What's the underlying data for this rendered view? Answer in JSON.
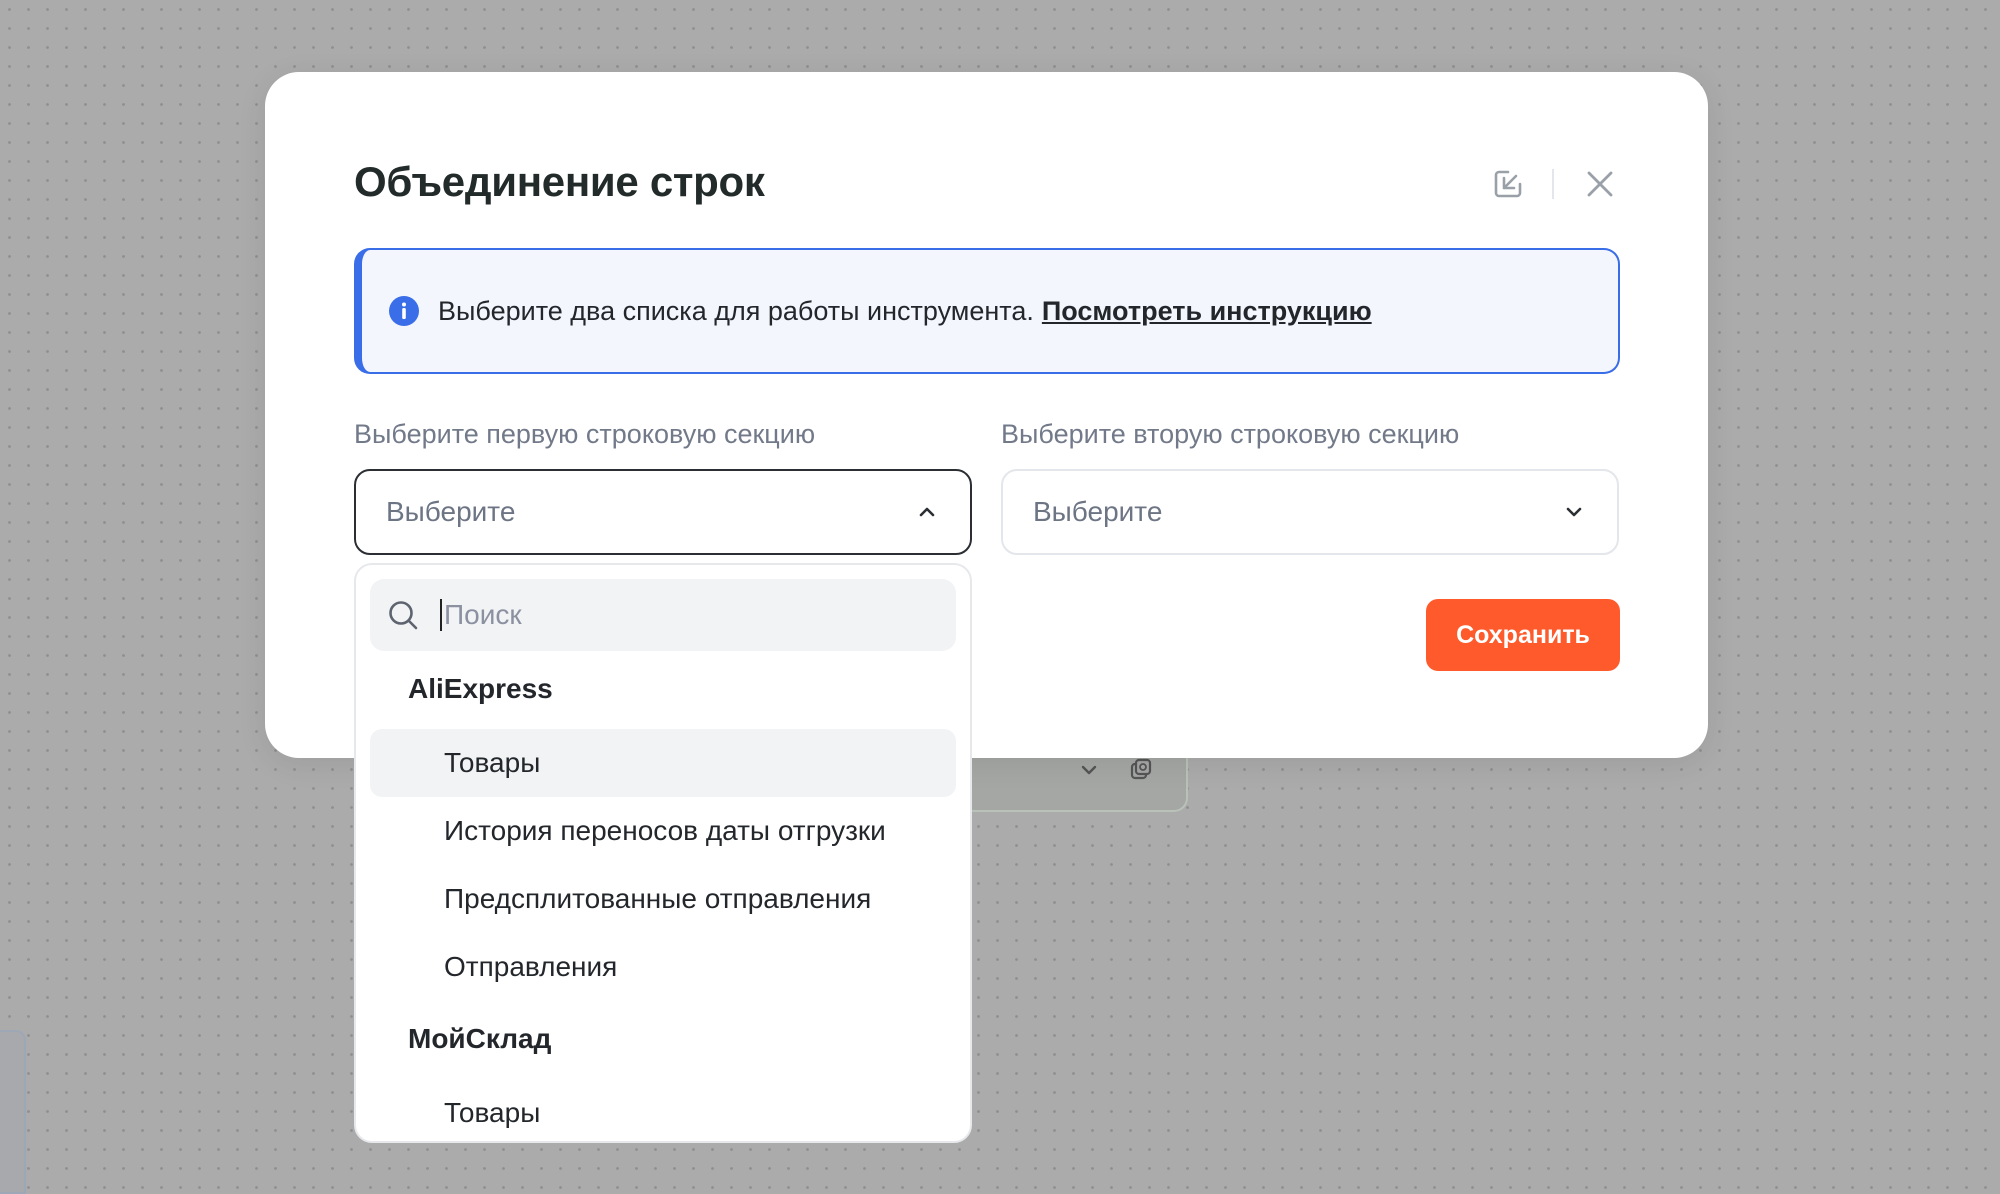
{
  "modal": {
    "title": "Объединение строк",
    "info": {
      "text": "Выберите два списка для работы инструмента.",
      "link": "Посмотреть инструкцию"
    },
    "first_section": {
      "label": "Выберите первую строковую секцию",
      "value": "Выберите",
      "state": "open"
    },
    "second_section": {
      "label": "Выберите вторую строковую секцию",
      "value": "Выберите",
      "state": "closed"
    },
    "save_label": "Сохранить"
  },
  "dropdown": {
    "search_placeholder": "Поиск",
    "search_value": "",
    "groups": [
      {
        "name": "AliExpress",
        "items": [
          {
            "label": "Товары",
            "highlighted": true
          },
          {
            "label": "История переносов даты отгрузки",
            "highlighted": false
          },
          {
            "label": "Предсплитованные отправления",
            "highlighted": false
          },
          {
            "label": "Отправления",
            "highlighted": false
          }
        ]
      },
      {
        "name": "МойСклад",
        "items": [
          {
            "label": "Товары",
            "highlighted": false
          }
        ]
      }
    ]
  },
  "icons": {
    "header": [
      "collapse-arrow-icon",
      "close-icon"
    ],
    "info": "info-icon",
    "search": "search-icon",
    "chevron_up": "chevron-up-icon",
    "chevron_down": "chevron-down-icon"
  },
  "colors": {
    "accent_blue": "#3a6ee8",
    "info_background": "#f4f6fd",
    "save_button": "#ff5a2c",
    "highlight_row": "#f2f3f5",
    "overlay": "#ababab"
  }
}
